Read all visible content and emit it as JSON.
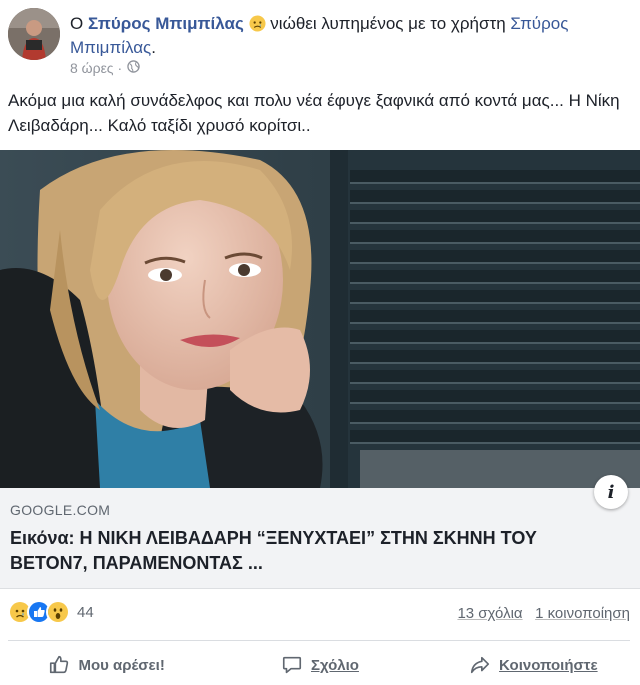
{
  "post": {
    "prefix": "Ο ",
    "author": "Σπύρος Μπιμπίλας",
    "feeling_text": " νιώθει λυπημένος με το χρήστη ",
    "tagged_user": "Σπύρος Μπιμπίλας",
    "tagged_suffix": ".",
    "timestamp": "8 ώρες ·",
    "feeling_icon": "sad-face-icon",
    "privacy_icon": "globe-icon",
    "text": "Ακόμα μια καλή συνάδελφος και πολυ νέα έφυγε ξαφνικά από κοντά μας... Η Νίκη Λειβαδάρη... Καλό ταξίδι χρυσό κορίτσι.."
  },
  "link": {
    "domain": "GOOGLE.COM",
    "title": "Εικόνα: Η ΝΙΚΗ ΛΕΙΒΑΔΑΡΗ “ΞΕΝΥΧΤΑΕΙ” ΣΤΗΝ ΣΚΗΝΗ ΤΟΥ ΒΕΤΟΝ7, ΠΑΡΑΜΕΝΟΝΤΑΣ ...",
    "info_icon": "i"
  },
  "engagement": {
    "reaction_count": "44",
    "comments": "13 σχόλια",
    "shares": "1 κοινοποίηση",
    "reactions": [
      "sad",
      "like",
      "wow"
    ]
  },
  "actions": {
    "like": "Μου αρέσει!",
    "comment": "Σχόλιο",
    "share": "Κοινοποιήστε"
  },
  "colors": {
    "link_blue": "#385898",
    "like_blue": "#1877f2",
    "reaction_yellow": "#f7c84a",
    "secondary_text": "#606770"
  }
}
